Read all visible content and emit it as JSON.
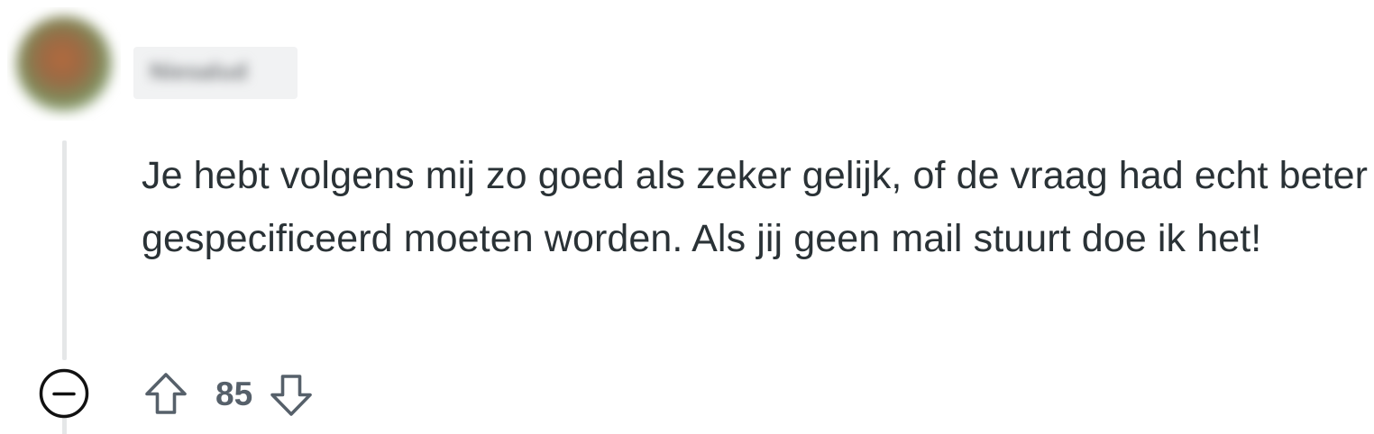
{
  "comment": {
    "author": "Niesalud",
    "body": "Je hebt volgens mij zo goed als zeker gelijk, of de vraag had echt beter gespecificeerd moeten worden. Als jij geen mail stuurt doe ik het!",
    "score": "85"
  },
  "icons": {
    "collapse": "minus-circle-icon",
    "upvote": "arrow-up-outline-icon",
    "downvote": "arrow-down-outline-icon"
  },
  "colors": {
    "text": "#2a3236",
    "icon": "#56606a",
    "thread_line": "#e5e7e8"
  }
}
